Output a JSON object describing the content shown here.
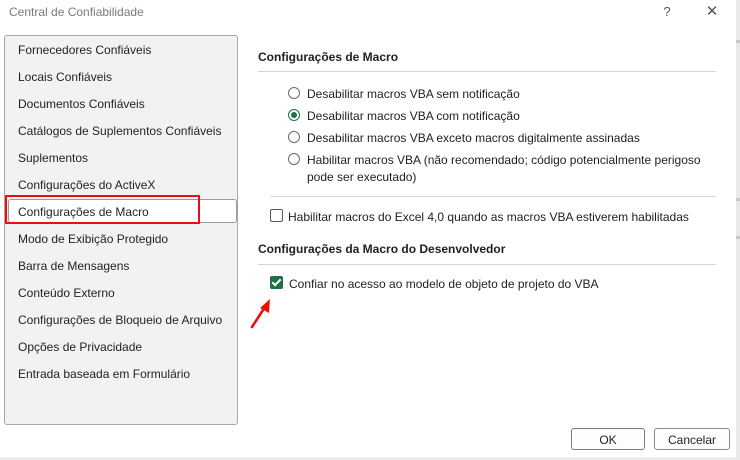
{
  "window": {
    "title": "Central de Confiabilidade",
    "help_glyph": "?",
    "close_glyph": "✕"
  },
  "sidebar": {
    "items": [
      {
        "label": "Fornecedores Confiáveis"
      },
      {
        "label": "Locais Confiáveis"
      },
      {
        "label": "Documentos Confiáveis"
      },
      {
        "label": "Catálogos de Suplementos Confiáveis"
      },
      {
        "label": "Suplementos"
      },
      {
        "label": "Configurações do ActiveX"
      },
      {
        "label": "Configurações de Macro",
        "selected": true
      },
      {
        "label": "Modo de Exibição Protegido"
      },
      {
        "label": "Barra de Mensagens"
      },
      {
        "label": "Conteúdo Externo"
      },
      {
        "label": "Configurações de Bloqueio de Arquivo"
      },
      {
        "label": "Opções de Privacidade"
      },
      {
        "label": "Entrada baseada em Formulário"
      }
    ]
  },
  "macro_settings": {
    "title": "Configurações de Macro",
    "options": [
      {
        "label": "Desabilitar macros VBA sem notificação",
        "checked": false
      },
      {
        "label": "Desabilitar macros VBA com notificação",
        "checked": true
      },
      {
        "label": "Desabilitar macros VBA exceto macros digitalmente assinadas",
        "checked": false
      },
      {
        "label": "Habilitar macros VBA (não recomendado; código potencialmente perigoso",
        "checked": false,
        "label_line2": "pode ser executado)"
      }
    ],
    "excel4_checkbox": {
      "label": "Habilitar macros do Excel 4,0 quando as macros VBA estiverem habilitadas",
      "checked": false
    }
  },
  "developer_settings": {
    "title": "Configurações da Macro do Desenvolvedor",
    "vba_checkbox": {
      "label": "Confiar no acesso ao modelo de objeto de projeto do VBA",
      "checked": true
    }
  },
  "buttons": {
    "ok": "OK",
    "cancel": "Cancelar"
  },
  "colors": {
    "accent_green": "#1e7145",
    "highlight_red": "#e8100e"
  }
}
